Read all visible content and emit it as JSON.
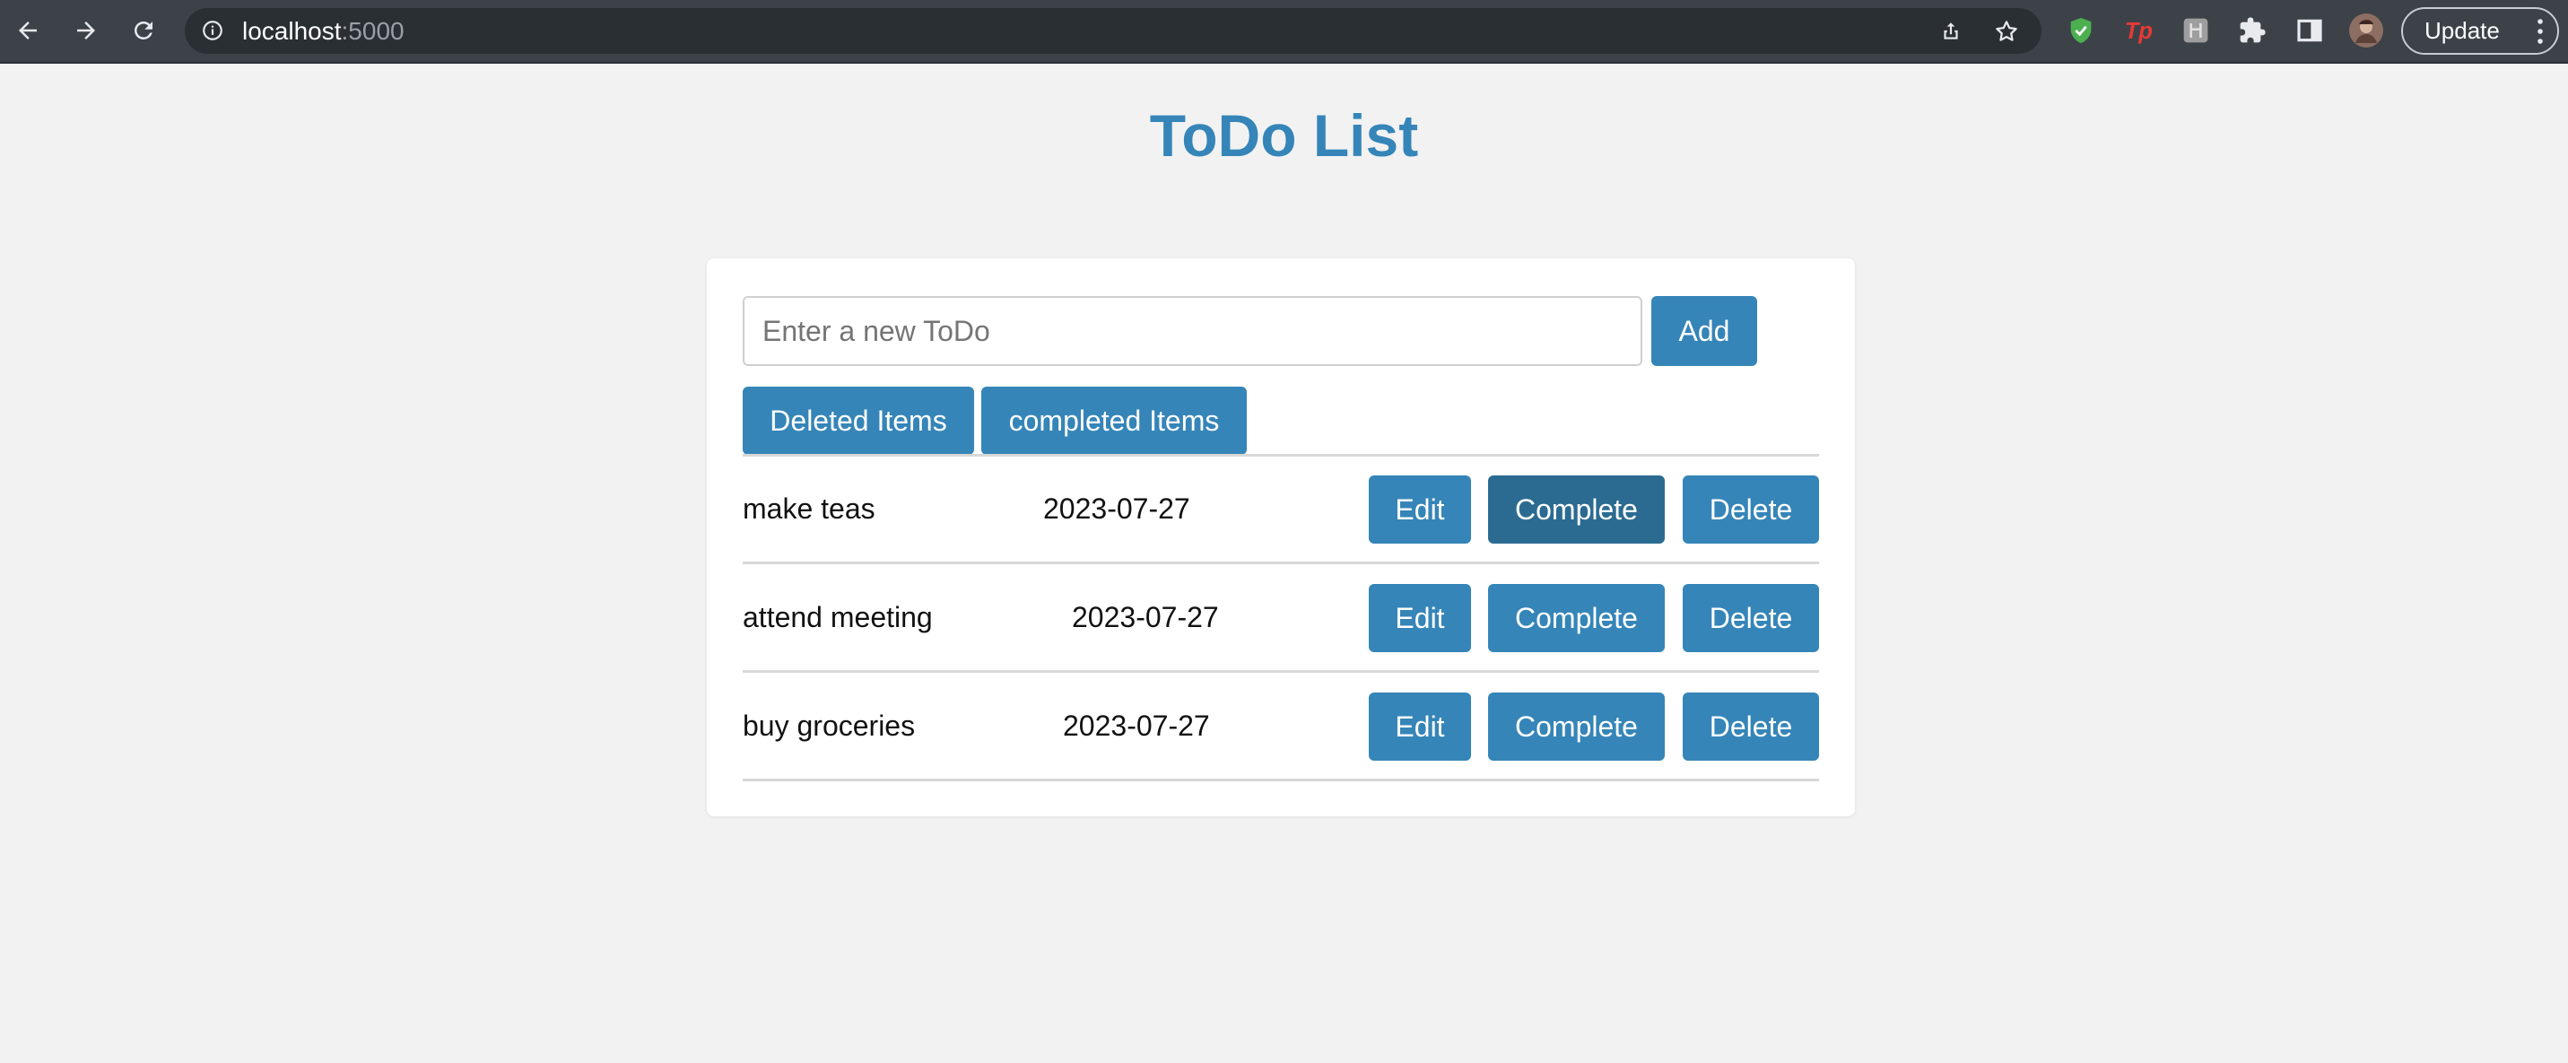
{
  "browser": {
    "url_host": "localhost",
    "url_port": ":5000",
    "update_label": "Update"
  },
  "page": {
    "title": "ToDo List"
  },
  "form": {
    "input_placeholder": "Enter a new ToDo",
    "input_value": "",
    "add_label": "Add"
  },
  "filters": {
    "deleted_label": "Deleted Items",
    "completed_label": "completed Items"
  },
  "todos": [
    {
      "text": "make teas",
      "date": "2023-07-27",
      "edit": "Edit",
      "complete": "Complete",
      "delete": "Delete"
    },
    {
      "text": "attend meeting",
      "date": "2023-07-27",
      "edit": "Edit",
      "complete": "Complete",
      "delete": "Delete"
    },
    {
      "text": "buy groceries",
      "date": "2023-07-27",
      "edit": "Edit",
      "complete": "Complete",
      "delete": "Delete"
    }
  ],
  "colors": {
    "accent": "#3585b8",
    "accent_hover": "#2b6b92",
    "background": "#f2f2f2",
    "chrome": "#3c4248"
  },
  "icons": [
    "back-arrow-icon",
    "forward-arrow-icon",
    "reload-icon",
    "info-icon",
    "share-icon",
    "star-icon",
    "shield-extension-icon",
    "tp-extension-icon",
    "box-extension-icon",
    "puzzle-icon",
    "sidepanel-icon",
    "avatar",
    "kebab-menu-icon"
  ]
}
